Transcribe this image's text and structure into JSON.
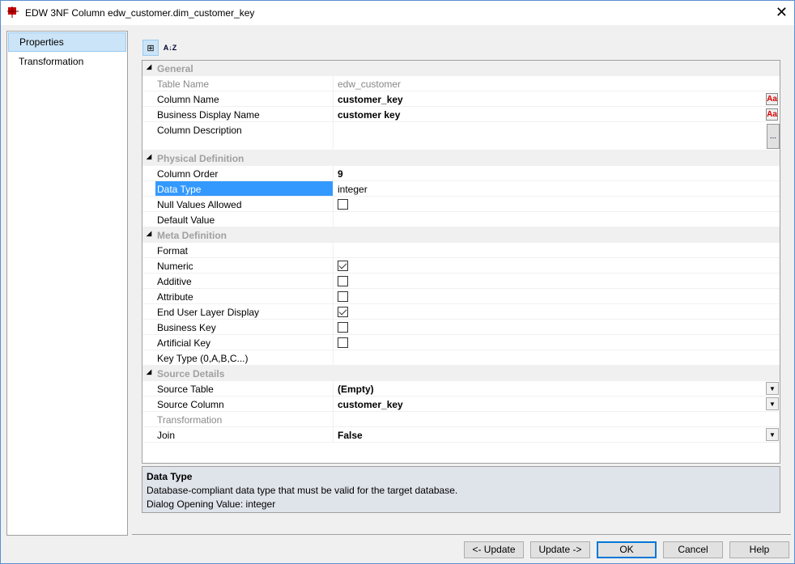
{
  "window": {
    "title": "EDW 3NF Column edw_customer.dim_customer_key",
    "close": "✕"
  },
  "nav": [
    {
      "label": "Properties",
      "selected": true
    },
    {
      "label": "Transformation",
      "selected": false
    }
  ],
  "toolbar": {
    "categorized": "⊞",
    "alphabetical": "A↓Z"
  },
  "grid": [
    {
      "category": "General"
    },
    {
      "label": "Table Name",
      "value": "edw_customer",
      "disabled": true
    },
    {
      "label": "Column Name",
      "value": "customer_key",
      "bold": true,
      "editor": "Aa"
    },
    {
      "label": "Business Display Name",
      "value": "customer key",
      "bold": true,
      "editor": "Aa"
    },
    {
      "label": "Column Description",
      "value": "",
      "tall": true,
      "editor": "..."
    },
    {
      "category": "Physical Definition"
    },
    {
      "label": "Column Order",
      "value": "9",
      "bold": true
    },
    {
      "label": "Data Type",
      "value": "integer",
      "selected": true
    },
    {
      "label": "Null Values Allowed",
      "checkbox": false
    },
    {
      "label": "Default Value",
      "value": ""
    },
    {
      "category": "Meta Definition"
    },
    {
      "label": "Format",
      "value": ""
    },
    {
      "label": "Numeric",
      "checkbox": true
    },
    {
      "label": "Additive",
      "checkbox": false
    },
    {
      "label": "Attribute",
      "checkbox": false
    },
    {
      "label": "End User Layer Display",
      "checkbox": true
    },
    {
      "label": "Business Key",
      "checkbox": false
    },
    {
      "label": "Artificial Key",
      "checkbox": false
    },
    {
      "label": "Key Type (0,A,B,C...)",
      "value": ""
    },
    {
      "category": "Source Details"
    },
    {
      "label": "Source Table",
      "value": "(Empty)",
      "bold": true,
      "dropdown": true
    },
    {
      "label": "Source Column",
      "value": "customer_key",
      "bold": true,
      "dropdown": true
    },
    {
      "label": "Transformation",
      "value": "",
      "disabled": true
    },
    {
      "label": "Join",
      "value": "False",
      "bold": true,
      "dropdown": true
    }
  ],
  "description": {
    "title": "Data Type",
    "text": "Database-compliant data type that must be valid for the target database.",
    "opening": "Dialog Opening Value: integer"
  },
  "buttons": {
    "update_prev": "<- Update",
    "update_next": "Update ->",
    "ok": "OK",
    "cancel": "Cancel",
    "help": "Help"
  }
}
